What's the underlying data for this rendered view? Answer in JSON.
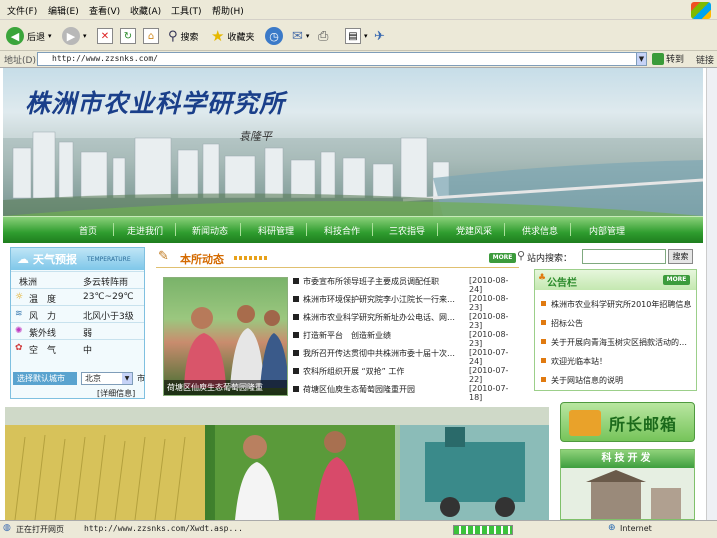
{
  "browser": {
    "menu": [
      "文件(F)",
      "编辑(E)",
      "查看(V)",
      "收藏(A)",
      "工具(T)",
      "帮助(H)"
    ],
    "toolbar": {
      "back": "后退",
      "search": "搜索",
      "favorites": "收藏夹"
    },
    "address_label": "地址(D)",
    "address": "http://www.zzsnks.com/",
    "go": "转到",
    "links": "链接",
    "status": {
      "text": "正在打开网页",
      "url": "http://www.zzsnks.com/Xwdt.asp...",
      "zone": "Internet"
    }
  },
  "site": {
    "title": "株洲市农业科学研究所",
    "signature": "袁隆平",
    "nav": [
      "首页",
      "走进我们",
      "新闻动态",
      "科研管理",
      "科技合作",
      "三农指导",
      "党建风采",
      "供求信息",
      "内部管理"
    ]
  },
  "weather": {
    "title": "天气预报",
    "title_en": "TEMPERATURE",
    "city": "株洲",
    "condition": "多云转阵雨",
    "rows": [
      {
        "label": "温　度",
        "value": "23℃~29℃",
        "icon": "sun-icon"
      },
      {
        "label": "风　力",
        "value": "北风小于3级",
        "icon": "wind-icon"
      },
      {
        "label": "紫外线",
        "value": "弱",
        "icon": "uv-icon"
      },
      {
        "label": "空　气",
        "value": "中",
        "icon": "air-icon"
      }
    ],
    "select_label": "选择默认城市",
    "selected_city": "北京",
    "city_unit": "市",
    "detail": "[详细信息]"
  },
  "news": {
    "title": "本所动态",
    "more": "MORE",
    "photo_caption": "荷塘区仙庾生态葡萄园隆重",
    "items": [
      {
        "title": "市委宣布所领导班子主要成员调配任职",
        "date": "[2010-08-24]"
      },
      {
        "title": "株洲市环境保护研究院李小江院长一行来…",
        "date": "[2010-08-23]"
      },
      {
        "title": "株洲市农业科学研究所新址办公电话、网…",
        "date": "[2010-08-23]"
      },
      {
        "title": "打造新平台　创造新业绩",
        "date": "[2010-08-23]"
      },
      {
        "title": "我所召开传达贯彻中共株洲市委十届十次…",
        "date": "[2010-07-24]"
      },
      {
        "title": "农科所组织开展 “双抢” 工作",
        "date": "[2010-07-22]"
      },
      {
        "title": "荷塘区仙庾生态葡萄园隆重开园",
        "date": "[2010-07-18]"
      }
    ]
  },
  "search": {
    "label": "站内搜索：",
    "button": "搜索"
  },
  "notice": {
    "title": "公告栏",
    "more": "MORE",
    "items": [
      "株洲市农业科学研究所2010年招聘信息",
      "招标公告",
      "关于开展向青海玉树灾区捐款活动的…",
      "欢迎光临本站！",
      "关于网站信息的说明"
    ]
  },
  "mailbox": "所长邮箱",
  "tech": "科技开发",
  "colors": {
    "nav_green": "#2f9d2f",
    "title_blue": "#1a3f8a",
    "news_orange": "#d46a00"
  }
}
